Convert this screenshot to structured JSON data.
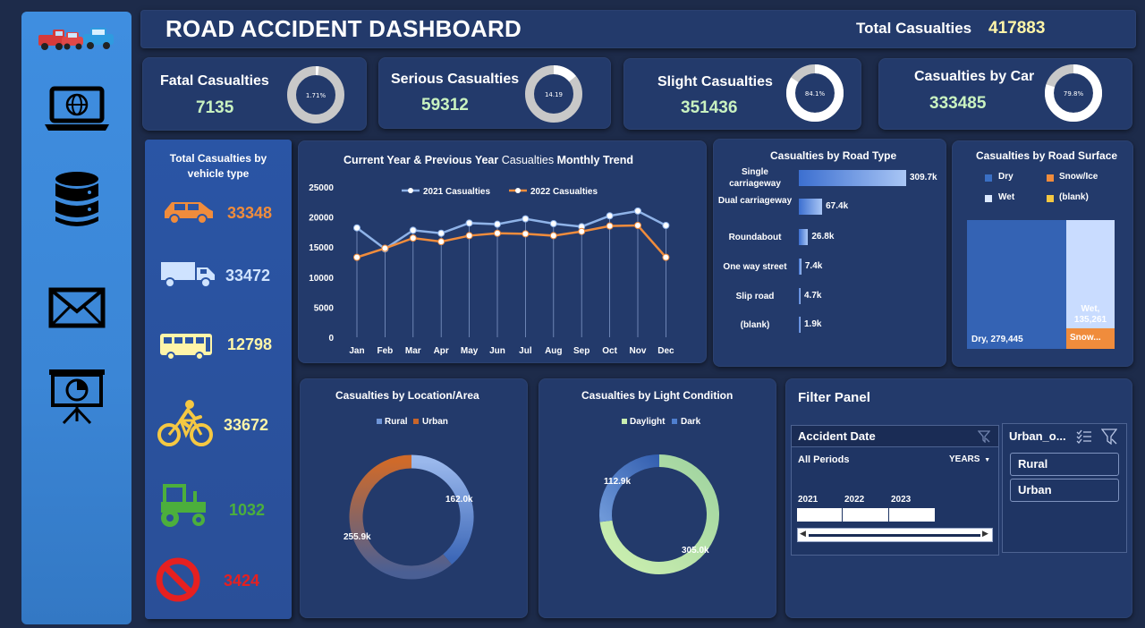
{
  "header": {
    "title": "ROAD ACCIDENT DASHBOARD",
    "total_label": "Total Casualties",
    "total_value": "417883"
  },
  "sidebar": {
    "items": [
      {
        "icon": "cars-logo-icon"
      },
      {
        "icon": "laptop-globe-icon"
      },
      {
        "icon": "database-icon"
      },
      {
        "icon": "mail-icon"
      },
      {
        "icon": "presentation-icon"
      }
    ]
  },
  "kpis": [
    {
      "label": "Fatal Casualties",
      "value": "7135",
      "pct_label": "1.71%",
      "pct": 1.71
    },
    {
      "label": "Serious Casualties",
      "value": "59312",
      "pct_label": "14.19",
      "pct": 14.19
    },
    {
      "label": "Slight Casualties",
      "value": "351436",
      "pct_label": "84.1%",
      "pct": 84.1
    },
    {
      "label": "Casualties by Car",
      "value": "333485",
      "pct_label": "79.8%",
      "pct": 79.8
    }
  ],
  "vehicles": {
    "title": "Total Casualties by vehicle type",
    "items": [
      {
        "icon": "car-icon",
        "value": "33348",
        "color": "#f08c3c"
      },
      {
        "icon": "truck-icon",
        "value": "33472",
        "color": "#cfe3ff"
      },
      {
        "icon": "bus-icon",
        "value": "12798",
        "color": "#fff5a8"
      },
      {
        "icon": "bicycle-icon",
        "value": "33672",
        "color": "#f5c842"
      },
      {
        "icon": "tractor-icon",
        "value": "1032",
        "color": "#4caf3c"
      },
      {
        "icon": "no-entry-icon",
        "value": "3424",
        "color": "#e62020"
      }
    ]
  },
  "trend": {
    "title_bold1": "Current Year & Previous Year",
    "title_mid": " Casualties ",
    "title_bold2": "Monthly Trend"
  },
  "road_type": {
    "title": "Casualties by Road Type"
  },
  "road_surface": {
    "title": "Casualties by Road Surface",
    "legend": [
      "Dry",
      "Snow/Ice",
      "Wet",
      "(blank)"
    ],
    "legend_colors": [
      "#3a6fc4",
      "#f08c3c",
      "#dce9ff",
      "#f5c842"
    ],
    "labels": {
      "dry": "Dry, 279,445",
      "wet": "Wet,",
      "wet_value": "135,261",
      "snow": "Snow..."
    }
  },
  "location": {
    "title": "Casualties by Location/Area",
    "legend": [
      "Rural",
      "Urban"
    ],
    "labels": {
      "rural": "162.0k",
      "urban": "255.9k"
    }
  },
  "light": {
    "title": "Casualties by Light Condition",
    "legend": [
      "Daylight",
      "Dark"
    ],
    "labels": {
      "dark": "112.9k",
      "daylight": "305.0k"
    }
  },
  "filter": {
    "title": "Filter Panel",
    "date_slicer": {
      "header": "Accident Date",
      "periods": "All Periods",
      "granularity": "YEARS",
      "years": [
        "2021",
        "2022",
        "2023"
      ]
    },
    "area_slicer": {
      "header": "Urban_o...",
      "options": [
        "Rural",
        "Urban"
      ]
    }
  },
  "chart_data": [
    {
      "type": "line",
      "categories": [
        "Jan",
        "Feb",
        "Mar",
        "Apr",
        "May",
        "Jun",
        "Jul",
        "Aug",
        "Sep",
        "Oct",
        "Nov",
        "Dec"
      ],
      "series": [
        {
          "name": "2021 Casualties",
          "color": "#8fb3e8",
          "values": [
            18200,
            14700,
            17800,
            17300,
            19000,
            18800,
            19700,
            18900,
            18400,
            20200,
            21000,
            18600
          ]
        },
        {
          "name": "2022 Casualties",
          "color": "#f08c3c",
          "values": [
            13300,
            14800,
            16500,
            15900,
            16900,
            17300,
            17200,
            16900,
            17600,
            18500,
            18600,
            13300
          ]
        }
      ],
      "ylim": [
        0,
        25000
      ],
      "yticks": [
        0,
        5000,
        10000,
        15000,
        20000,
        25000
      ],
      "legend": "top"
    },
    {
      "type": "bar",
      "orientation": "horizontal",
      "categories": [
        "Single carriageway",
        "Dual carriageway",
        "Roundabout",
        "One way street",
        "Slip road",
        "(blank)"
      ],
      "values": [
        309700,
        67400,
        26800,
        7400,
        4700,
        1900
      ],
      "data_labels": [
        "309.7k",
        "67.4k",
        "26.8k",
        "7.4k",
        "4.7k",
        "1.9k"
      ]
    },
    {
      "type": "treemap",
      "categories": [
        "Dry",
        "Wet",
        "Snow/Ice",
        "(blank)"
      ],
      "values": [
        279445,
        135261,
        3000,
        0
      ]
    },
    {
      "type": "pie",
      "style": "donut",
      "categories": [
        "Rural",
        "Urban"
      ],
      "values": [
        162000,
        255900
      ],
      "colors": [
        "#6f96d8",
        "#c8652a"
      ]
    },
    {
      "type": "pie",
      "style": "donut",
      "categories": [
        "Daylight",
        "Dark"
      ],
      "values": [
        305000,
        112900
      ],
      "colors": [
        "#c9eeb0",
        "#4f7fcf"
      ]
    }
  ]
}
